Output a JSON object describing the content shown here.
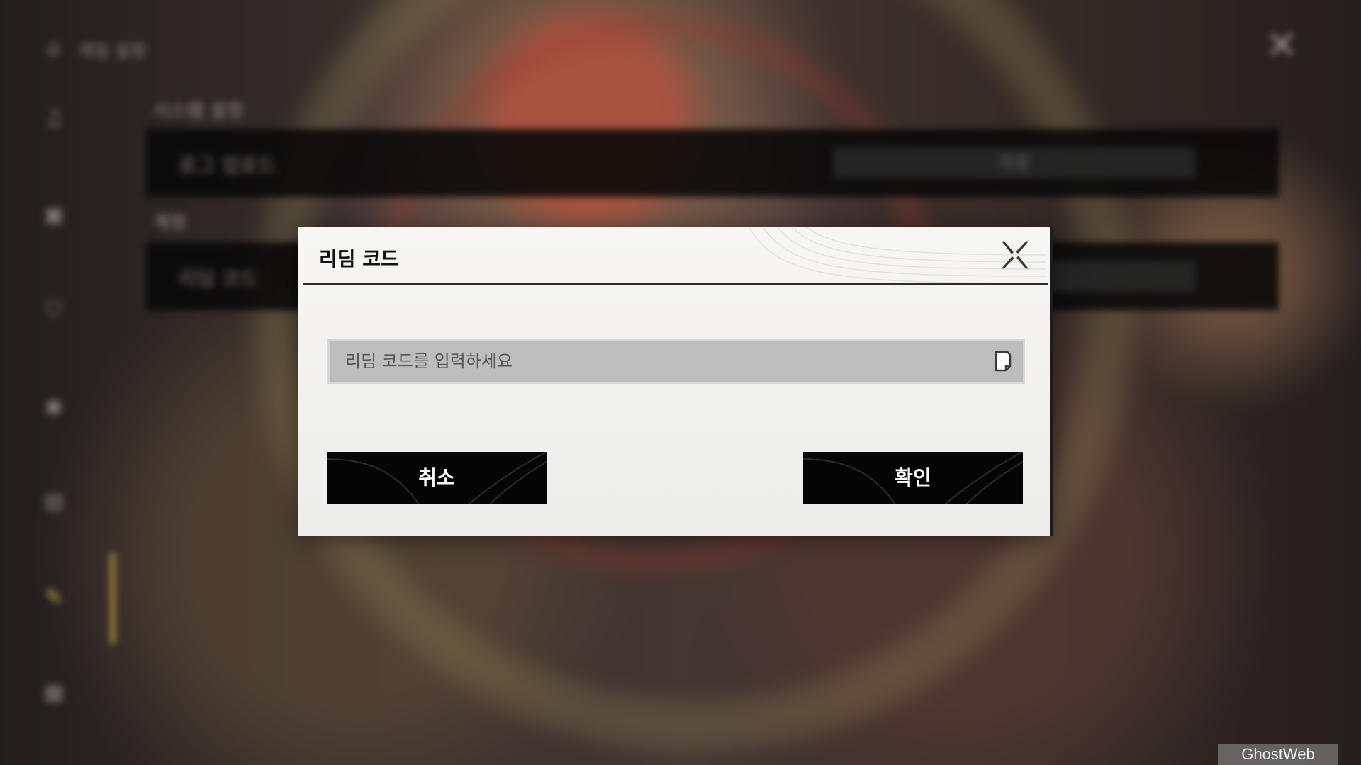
{
  "settings_screen": {
    "title": "게임 설정",
    "sections": [
      {
        "heading": "시스템 설정",
        "row_label": "로그 업로드",
        "row_value": "저장"
      },
      {
        "heading": "계정",
        "row_label": "리딤 코드",
        "row_value": ""
      }
    ],
    "sidebar_icons": [
      "home-icon",
      "music-icon",
      "display-icon",
      "shield-icon",
      "gamepad-icon",
      "keyboard-icon",
      "account-icon",
      "more-icon"
    ]
  },
  "redeem_dialog": {
    "title": "리딤 코드",
    "input": {
      "value": "",
      "placeholder": "리딤 코드를 입력하세요"
    },
    "cancel_label": "취소",
    "confirm_label": "확인"
  },
  "watermark": "GhostWeb",
  "colors": {
    "modal_bg": "#f7f6f4",
    "button_bg": "#050505",
    "input_bg": "#bdbdbd",
    "accent_gold": "#d8b94a",
    "close_icon": "#6b5d45"
  }
}
